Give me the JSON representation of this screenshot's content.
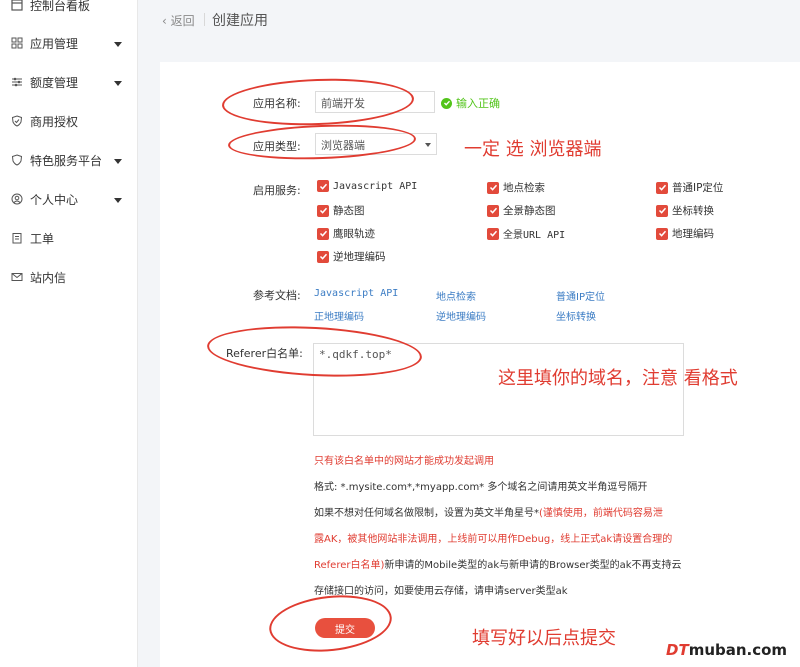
{
  "sidebar": {
    "items": [
      {
        "label": "控制台看板",
        "icon": "dashboard-icon"
      },
      {
        "label": "应用管理",
        "icon": "grid-icon",
        "expandable": true
      },
      {
        "label": "额度管理",
        "icon": "sliders-icon",
        "expandable": true
      },
      {
        "label": "商用授权",
        "icon": "shield-icon"
      },
      {
        "label": "特色服务平台",
        "icon": "heart-shield-icon",
        "expandable": true
      },
      {
        "label": "个人中心",
        "icon": "user-circle-icon",
        "expandable": true
      },
      {
        "label": "工单",
        "icon": "clipboard-icon"
      },
      {
        "label": "站内信",
        "icon": "mail-icon"
      }
    ]
  },
  "header": {
    "back_label": "‹ 返回",
    "title": "创建应用"
  },
  "form": {
    "app_name_label": "应用名称:",
    "app_name_value": "前端开发",
    "app_name_status": "输入正确",
    "app_type_label": "应用类型:",
    "app_type_value": "浏览器端",
    "services_label": "启用服务:",
    "services": [
      {
        "label": "Javascript API",
        "checked": true,
        "mono": true
      },
      {
        "label": "地点检索",
        "checked": true
      },
      {
        "label": "普通IP定位",
        "checked": true
      },
      {
        "label": "静态图",
        "checked": true
      },
      {
        "label": "全景静态图",
        "checked": true
      },
      {
        "label": "坐标转换",
        "checked": true
      },
      {
        "label": "鹰眼轨迹",
        "checked": true
      },
      {
        "label": "全景URL API",
        "checked": true
      },
      {
        "label": "地理编码",
        "checked": true
      },
      {
        "label": "逆地理编码",
        "checked": true
      }
    ],
    "docs_label": "参考文档:",
    "docs": [
      "Javascript API",
      "地点检索",
      "普通IP定位",
      "正地理编码",
      "逆地理编码",
      "坐标转换"
    ],
    "referer_label": "Referer白名单:",
    "referer_value": "*.qdkf.top*",
    "notes": {
      "line1": "只有该白名单中的网站才能成功发起调用",
      "line2": "格式: *.mysite.com*,*myapp.com* 多个域名之间请用英文半角逗号隔开",
      "line3a": "如果不想对任何域名做限制，设置为英文半角星号*",
      "line3b": "(谨慎使用，前端代码容易泄",
      "line4": "露AK，被其他网站非法调用，上线前可以用作Debug，线上正式ak请设置合理的",
      "line5a": "Referer白名单)",
      "line5b": "新申请的Mobile类型的ak与新申请的Browser类型的ak不再支持云",
      "line6": "存储接口的访问，如要使用云存储，请申请server类型ak"
    },
    "submit_label": "提交"
  },
  "annotations": {
    "type_note": "一定 选 浏览器端",
    "domain_note": "这里填你的域名，注意 看格式",
    "submit_note": "填写好以后点提交"
  },
  "watermark": {
    "brand": "DT",
    "rest": "muban.com"
  },
  "colors": {
    "accent": "#e8503e",
    "annotation": "#e03c31",
    "success": "#52c41a",
    "link": "#3b7cc4"
  }
}
